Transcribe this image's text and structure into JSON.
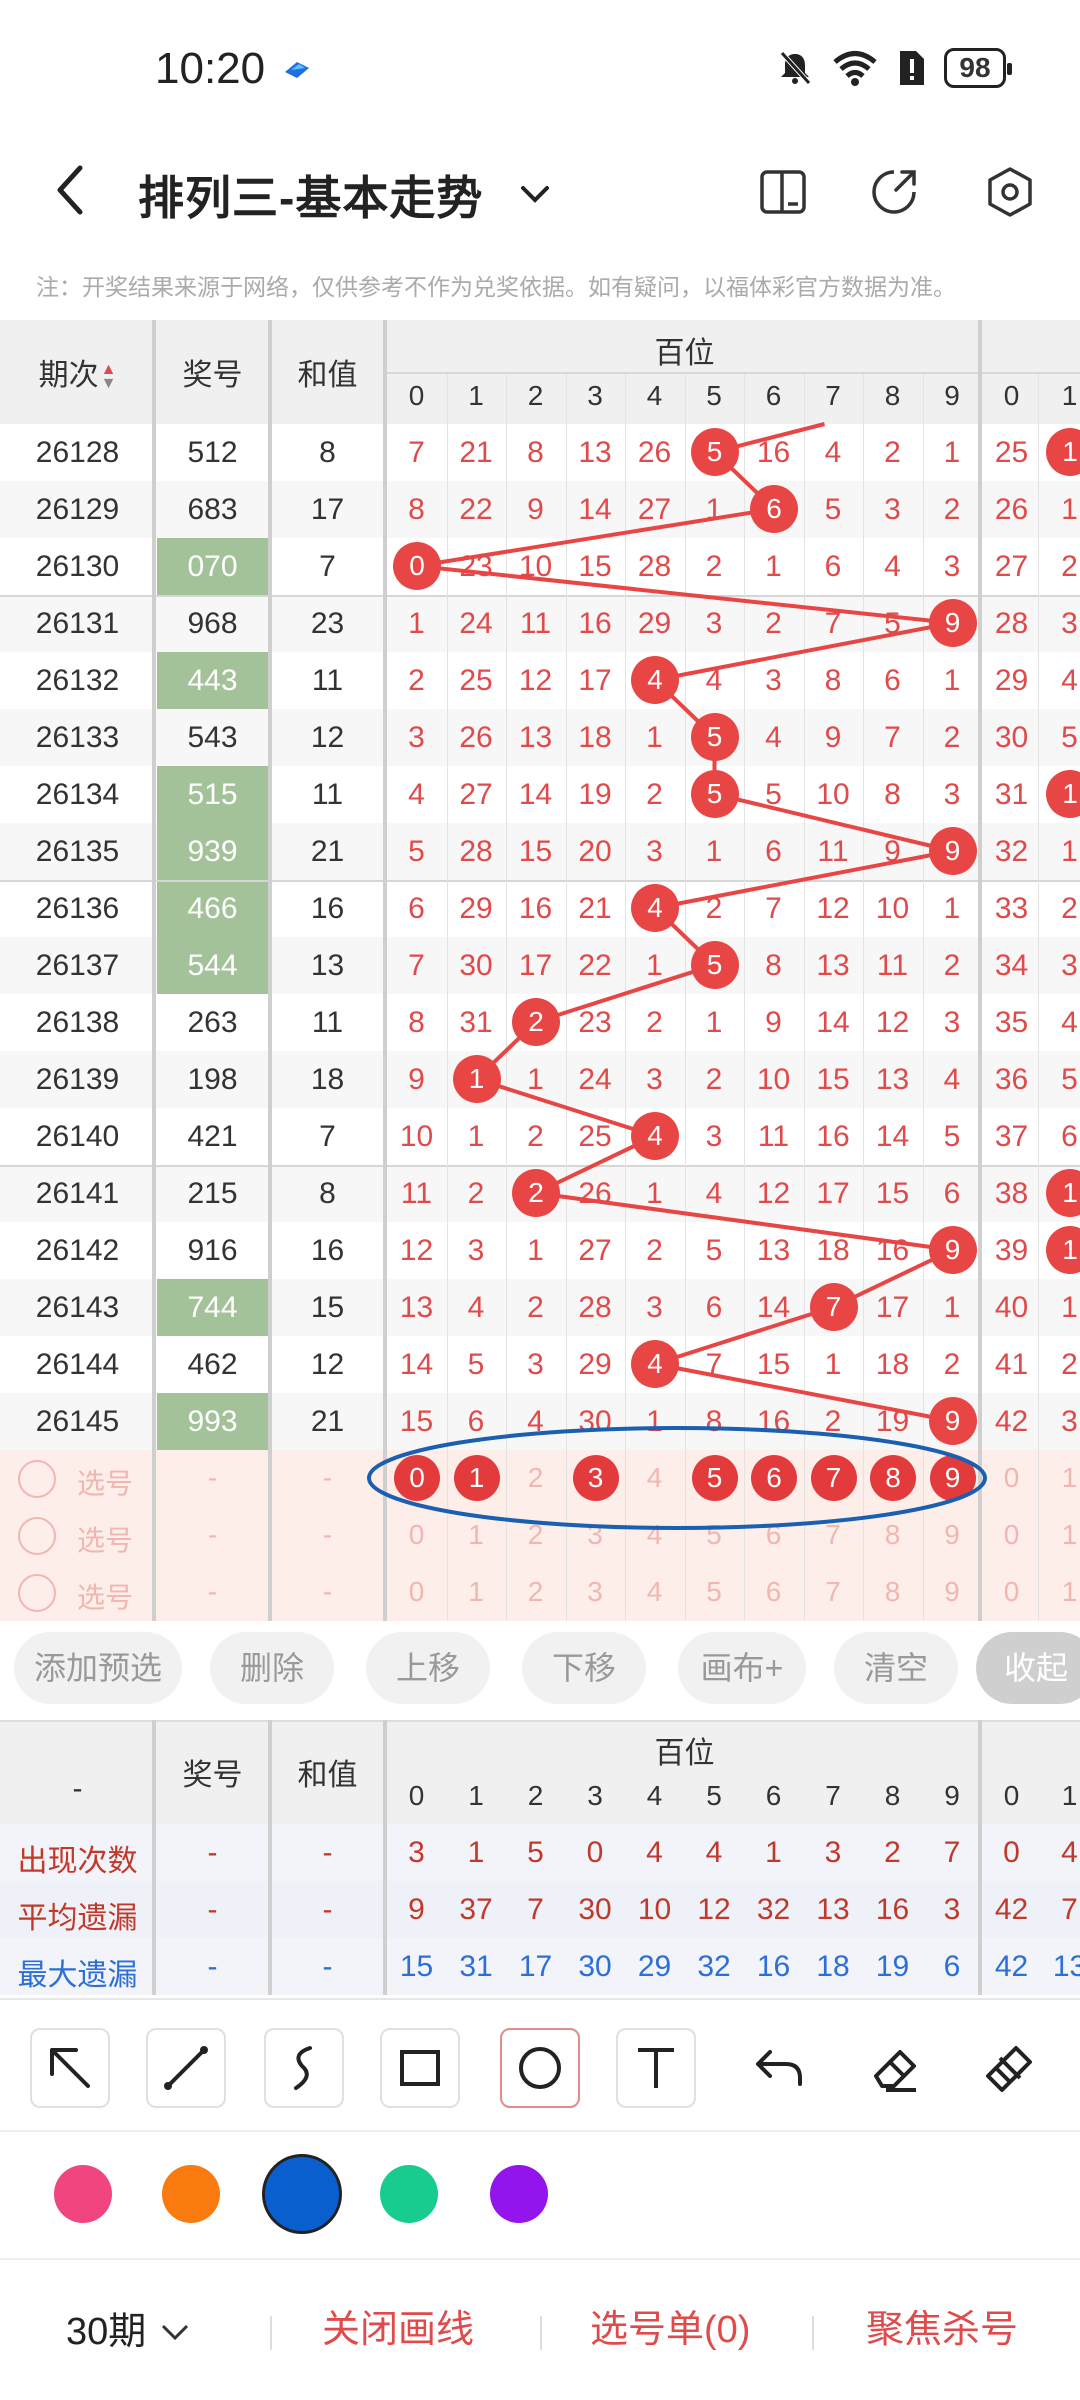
{
  "status": {
    "time": "10:20",
    "battery": "98"
  },
  "header": {
    "title": "排列三-基本走势"
  },
  "notice": "注：开奖结果来源于网络，仅供参考不作为兑奖依据。如有疑问，以福体彩官方数据为准。",
  "table": {
    "col_period": "期次",
    "col_award": "奖号",
    "col_sum": "和值",
    "group_label": "百位",
    "digits": [
      "0",
      "1",
      "2",
      "3",
      "4",
      "5",
      "6",
      "7",
      "8",
      "9"
    ],
    "next_digits": [
      "0",
      "1"
    ],
    "rows": [
      {
        "period": "26128",
        "award": "512",
        "sum": "8",
        "hl": false,
        "cells": [
          "7",
          "21",
          "8",
          "13",
          "26",
          "5",
          "16",
          "4",
          "2",
          "1"
        ],
        "ball": 5,
        "extra": [
          "25",
          "1"
        ],
        "extraBall": [
          false,
          true
        ]
      },
      {
        "period": "26129",
        "award": "683",
        "sum": "17",
        "hl": false,
        "cells": [
          "8",
          "22",
          "9",
          "14",
          "27",
          "1",
          "6",
          "5",
          "3",
          "2"
        ],
        "ball": 6,
        "extra": [
          "26",
          "1"
        ],
        "extraBall": [
          false,
          false
        ]
      },
      {
        "period": "26130",
        "award": "070",
        "sum": "7",
        "hl": true,
        "cells": [
          "0",
          "23",
          "10",
          "15",
          "28",
          "2",
          "1",
          "6",
          "4",
          "3"
        ],
        "ball": 0,
        "extra": [
          "27",
          "2"
        ],
        "extraBall": [
          false,
          false
        ]
      },
      {
        "period": "26131",
        "award": "968",
        "sum": "23",
        "hl": false,
        "cells": [
          "1",
          "24",
          "11",
          "16",
          "29",
          "3",
          "2",
          "7",
          "5",
          "9"
        ],
        "ball": 9,
        "extra": [
          "28",
          "3"
        ],
        "extraBall": [
          false,
          false
        ]
      },
      {
        "period": "26132",
        "award": "443",
        "sum": "11",
        "hl": true,
        "cells": [
          "2",
          "25",
          "12",
          "17",
          "4",
          "4",
          "3",
          "8",
          "6",
          "1"
        ],
        "ball": 4,
        "extra": [
          "29",
          "4"
        ],
        "extraBall": [
          false,
          false
        ]
      },
      {
        "period": "26133",
        "award": "543",
        "sum": "12",
        "hl": false,
        "cells": [
          "3",
          "26",
          "13",
          "18",
          "1",
          "5",
          "4",
          "9",
          "7",
          "2"
        ],
        "ball": 5,
        "extra": [
          "30",
          "5"
        ],
        "extraBall": [
          false,
          false
        ]
      },
      {
        "period": "26134",
        "award": "515",
        "sum": "11",
        "hl": true,
        "cells": [
          "4",
          "27",
          "14",
          "19",
          "2",
          "5",
          "5",
          "10",
          "8",
          "3"
        ],
        "ball": 5,
        "extra": [
          "31",
          "1"
        ],
        "extraBall": [
          false,
          true
        ]
      },
      {
        "period": "26135",
        "award": "939",
        "sum": "21",
        "hl": true,
        "cells": [
          "5",
          "28",
          "15",
          "20",
          "3",
          "1",
          "6",
          "11",
          "9",
          "9"
        ],
        "ball": 9,
        "extra": [
          "32",
          "1"
        ],
        "extraBall": [
          false,
          false
        ]
      },
      {
        "period": "26136",
        "award": "466",
        "sum": "16",
        "hl": true,
        "cells": [
          "6",
          "29",
          "16",
          "21",
          "4",
          "2",
          "7",
          "12",
          "10",
          "1"
        ],
        "ball": 4,
        "extra": [
          "33",
          "2"
        ],
        "extraBall": [
          false,
          false
        ]
      },
      {
        "period": "26137",
        "award": "544",
        "sum": "13",
        "hl": true,
        "cells": [
          "7",
          "30",
          "17",
          "22",
          "1",
          "5",
          "8",
          "13",
          "11",
          "2"
        ],
        "ball": 5,
        "extra": [
          "34",
          "3"
        ],
        "extraBall": [
          false,
          false
        ]
      },
      {
        "period": "26138",
        "award": "263",
        "sum": "11",
        "hl": false,
        "cells": [
          "8",
          "31",
          "2",
          "23",
          "2",
          "1",
          "9",
          "14",
          "12",
          "3"
        ],
        "ball": 2,
        "extra": [
          "35",
          "4"
        ],
        "extraBall": [
          false,
          false
        ]
      },
      {
        "period": "26139",
        "award": "198",
        "sum": "18",
        "hl": false,
        "cells": [
          "9",
          "1",
          "1",
          "24",
          "3",
          "2",
          "10",
          "15",
          "13",
          "4"
        ],
        "ball": 1,
        "extra": [
          "36",
          "5"
        ],
        "extraBall": [
          false,
          false
        ]
      },
      {
        "period": "26140",
        "award": "421",
        "sum": "7",
        "hl": false,
        "cells": [
          "10",
          "1",
          "2",
          "25",
          "4",
          "3",
          "11",
          "16",
          "14",
          "5"
        ],
        "ball": 4,
        "extra": [
          "37",
          "6"
        ],
        "extraBall": [
          false,
          false
        ]
      },
      {
        "period": "26141",
        "award": "215",
        "sum": "8",
        "hl": false,
        "cells": [
          "11",
          "2",
          "2",
          "26",
          "1",
          "4",
          "12",
          "17",
          "15",
          "6"
        ],
        "ball": 2,
        "extra": [
          "38",
          "1"
        ],
        "extraBall": [
          false,
          true
        ]
      },
      {
        "period": "26142",
        "award": "916",
        "sum": "16",
        "hl": false,
        "cells": [
          "12",
          "3",
          "1",
          "27",
          "2",
          "5",
          "13",
          "18",
          "16",
          "9"
        ],
        "ball": 9,
        "extra": [
          "39",
          "1"
        ],
        "extraBall": [
          false,
          true
        ]
      },
      {
        "period": "26143",
        "award": "744",
        "sum": "15",
        "hl": true,
        "cells": [
          "13",
          "4",
          "2",
          "28",
          "3",
          "6",
          "14",
          "7",
          "17",
          "1"
        ],
        "ball": 7,
        "extra": [
          "40",
          "1"
        ],
        "extraBall": [
          false,
          false
        ]
      },
      {
        "period": "26144",
        "award": "462",
        "sum": "12",
        "hl": false,
        "cells": [
          "14",
          "5",
          "3",
          "29",
          "4",
          "7",
          "15",
          "1",
          "18",
          "2"
        ],
        "ball": 4,
        "extra": [
          "41",
          "2"
        ],
        "extraBall": [
          false,
          false
        ]
      },
      {
        "period": "26145",
        "award": "993",
        "sum": "21",
        "hl": true,
        "cells": [
          "15",
          "6",
          "4",
          "30",
          "1",
          "8",
          "16",
          "2",
          "19",
          "9"
        ],
        "ball": 9,
        "extra": [
          "42",
          "3"
        ],
        "extraBall": [
          false,
          false
        ]
      }
    ],
    "select_label": "选号",
    "dash": "-",
    "select_rows": [
      {
        "selected": [
          0,
          1,
          3,
          5,
          6,
          7,
          8,
          9
        ]
      },
      {
        "selected": []
      },
      {
        "selected": []
      }
    ]
  },
  "buttons": [
    "添加预选",
    "删除",
    "上移",
    "下移",
    "画布+",
    "清空",
    "收起"
  ],
  "stats": {
    "col_first": "-",
    "col_award": "奖号",
    "col_sum": "和值",
    "group_label": "百位",
    "rows": [
      {
        "label": "出现次数",
        "color": "#c0392b",
        "values": [
          "3",
          "1",
          "5",
          "0",
          "4",
          "4",
          "1",
          "3",
          "2",
          "7"
        ],
        "extra": [
          "0",
          "4"
        ]
      },
      {
        "label": "平均遗漏",
        "color": "#c0392b",
        "values": [
          "9",
          "37",
          "7",
          "30",
          "10",
          "12",
          "32",
          "13",
          "16",
          "3"
        ],
        "extra": [
          "42",
          "7"
        ]
      },
      {
        "label": "最大遗漏",
        "color": "#2c6fd6",
        "values": [
          "15",
          "31",
          "17",
          "30",
          "29",
          "32",
          "16",
          "18",
          "19",
          "6"
        ],
        "extra": [
          "42",
          "13"
        ]
      }
    ]
  },
  "colors": [
    "#f0457f",
    "#f97a0f",
    "#0a5fcf",
    "#18cc8f",
    "#9414ee"
  ],
  "bottom": {
    "period": "30期",
    "close": "关闭画线",
    "selection": "选号单(0)",
    "focus": "聚焦杀号"
  }
}
